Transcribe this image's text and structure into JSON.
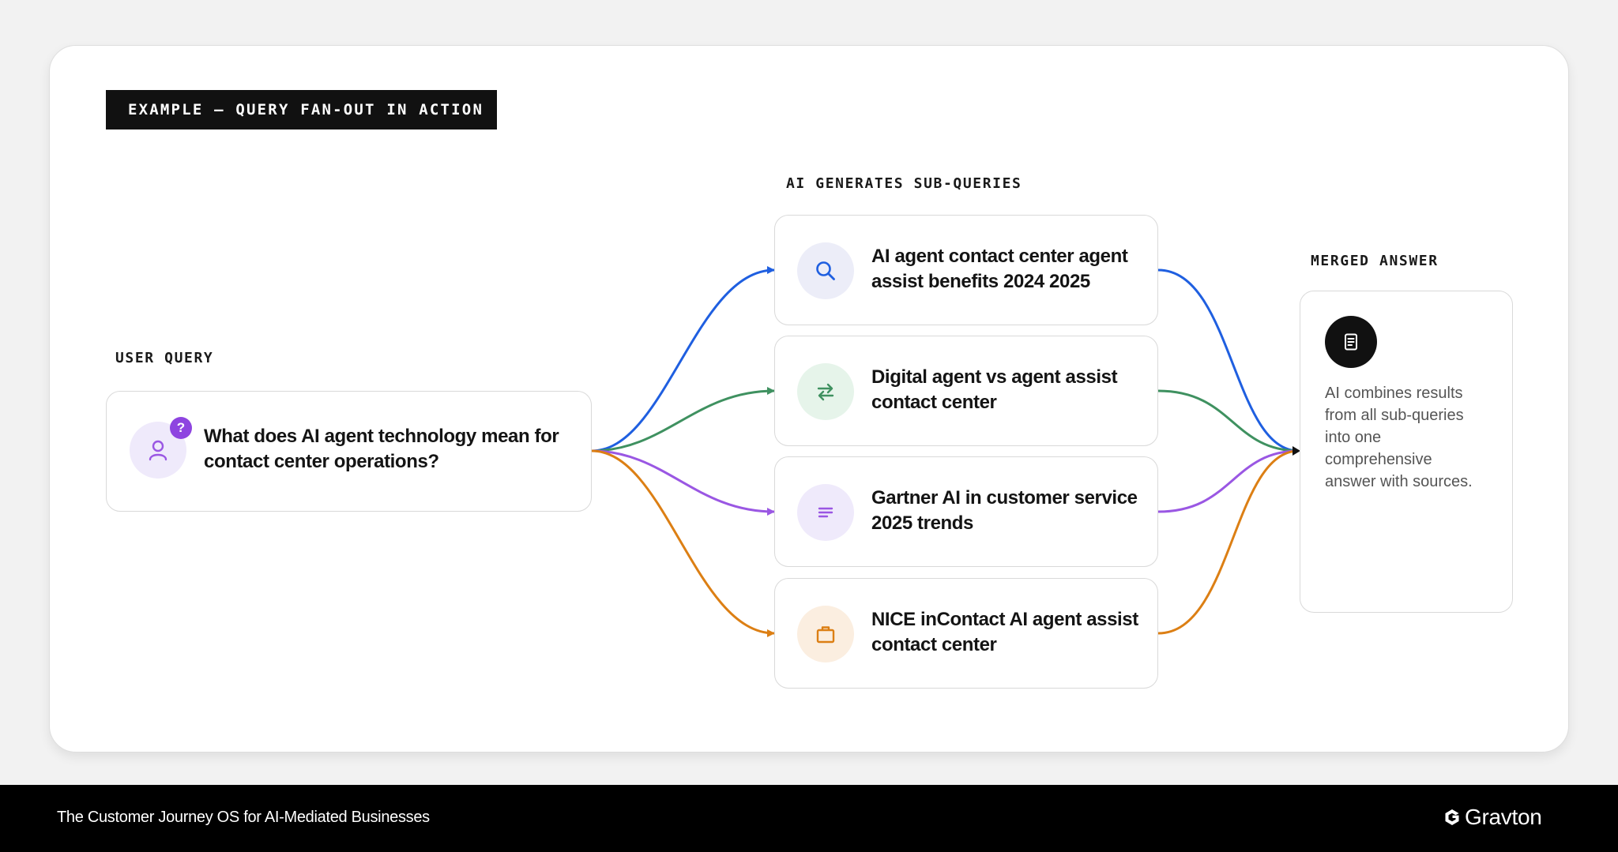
{
  "header": {
    "tag": "EXAMPLE — QUERY FAN-OUT IN ACTION"
  },
  "user_query": {
    "label": "USER QUERY",
    "badge": "?",
    "icon": "person-icon",
    "text_line1": "What does AI agent technology mean for",
    "text_line2": "contact center operations?"
  },
  "sub_queries": {
    "label": "AI GENERATES SUB-QUERIES",
    "items": [
      {
        "icon": "search-icon",
        "line1": "AI agent contact center agent",
        "line2": "assist benefits 2024 2025",
        "color": "#1f5fe0",
        "tint": "#ecedf8"
      },
      {
        "icon": "swap-arrows-icon",
        "line1": "Digital agent vs agent assist",
        "line2": "contact center",
        "color": "#3f9160",
        "tint": "#e6f4ea"
      },
      {
        "icon": "lines-icon",
        "line1": "Gartner AI in customer service",
        "line2": "2025 trends",
        "color": "#9a57e3",
        "tint": "#efeafb"
      },
      {
        "icon": "briefcase-icon",
        "line1": "NICE inContact AI agent assist",
        "line2": "contact center",
        "color": "#dc7f14",
        "tint": "#fbeee0"
      }
    ]
  },
  "merged_answer": {
    "label": "MERGED ANSWER",
    "icon": "document-icon",
    "lines": [
      "AI combines results",
      "from all sub-queries",
      "into one",
      "comprehensive",
      "answer with sources."
    ]
  },
  "footer": {
    "tagline": "The Customer Journey OS for AI-Mediated Businesses",
    "brand": "Gravton"
  },
  "colors": {
    "accent_purple": "#8e44e0",
    "merge_dot": "#111111"
  }
}
